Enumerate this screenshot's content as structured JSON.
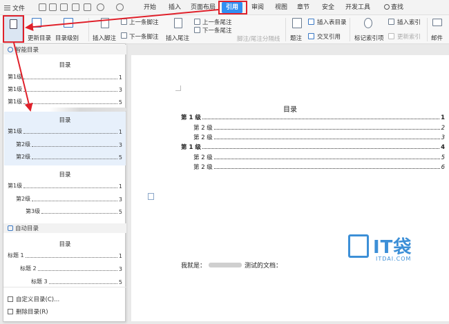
{
  "menubar": {
    "file_label": "文件",
    "tabs": [
      "开始",
      "插入",
      "页面布局",
      "引用",
      "审阅",
      "视图",
      "章节",
      "安全",
      "开发工具"
    ],
    "active_tab": "引用",
    "search_label": "查找"
  },
  "ribbon": {
    "toc_label": "目录",
    "update_toc": "更新目录",
    "toc_level": "目录级别",
    "insert_footnote": "插入脚注",
    "prev_footnote": "上一条脚注",
    "next_footnote": "下一条脚注",
    "insert_endnote": "插入尾注",
    "prev_endnote": "上一条尾注",
    "next_endnote": "下一条尾注",
    "footnote_sep": "脚注/尾注分隔线",
    "caption": "题注",
    "insert_table_toc": "插入表目录",
    "cross_ref": "交叉引用",
    "mark_index": "标记索引项",
    "insert_index": "插入索引",
    "update_index": "更新索引",
    "mail": "邮件"
  },
  "panel": {
    "smart_toc": "智能目录",
    "auto_toc": "自动目录",
    "block1": {
      "title": "目录",
      "lines": [
        {
          "label": "第1级",
          "page": "1"
        },
        {
          "label": "第1级",
          "page": "3"
        },
        {
          "label": "第1级",
          "page": "5"
        }
      ]
    },
    "block2": {
      "title": "目录",
      "lines": [
        {
          "label": "第1级",
          "page": "1"
        },
        {
          "label": "第2级",
          "page": "3"
        },
        {
          "label": "第2级",
          "page": "5"
        }
      ]
    },
    "block3": {
      "title": "目录",
      "lines": [
        {
          "label": "第1级",
          "page": "1"
        },
        {
          "label": "第2级",
          "page": "3"
        },
        {
          "label": "第3级",
          "page": "5"
        }
      ]
    },
    "block4": {
      "title": "目录",
      "lines": [
        {
          "label": "标题 1",
          "page": "1"
        },
        {
          "label": "标题 2",
          "page": "3"
        },
        {
          "label": "标题 3",
          "page": "5"
        }
      ]
    },
    "custom_toc": "自定义目录(C)...",
    "delete_toc": "删除目录(R)"
  },
  "document": {
    "title": "目录",
    "lines": [
      {
        "label": "第 1 级",
        "page": "1"
      },
      {
        "label": "第 2 级",
        "page": "2"
      },
      {
        "label": "第 2 级",
        "page": "3"
      },
      {
        "label": "第 1 级",
        "page": "4"
      },
      {
        "label": "第 2 级",
        "page": "5"
      },
      {
        "label": "第 2 级",
        "page": "6"
      }
    ],
    "body_prefix": "我就是：",
    "body_suffix": "测试的文档："
  },
  "watermark": {
    "logo": "IT袋",
    "url": "ITDAI.COM"
  },
  "colors": {
    "accent": "#2f8ef2",
    "highlight_frame": "#e0202a",
    "selection": "#e7f0fb",
    "watermark": "#3c8fd7"
  }
}
